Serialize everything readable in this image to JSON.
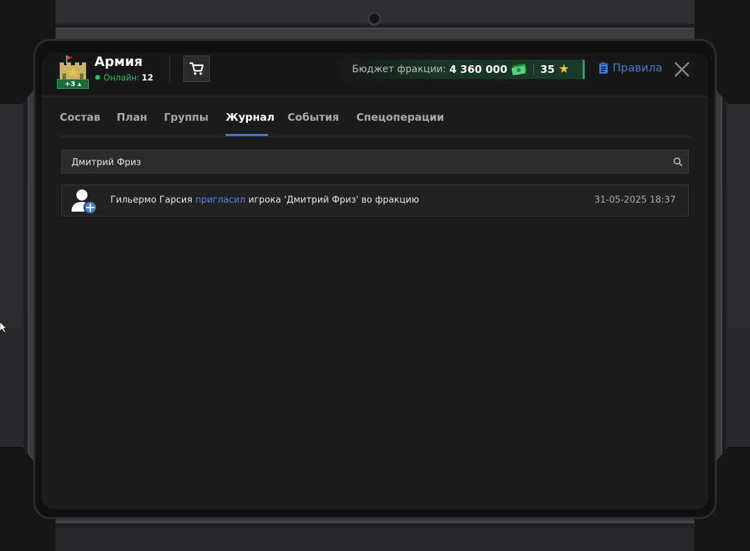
{
  "header": {
    "faction_name": "Армия",
    "online_label": "Онлайн:",
    "online_count": "12",
    "level_badge": "+3",
    "budget_label": "Бюджет фракции:",
    "budget_value": "4 360 000",
    "stars_value": "35",
    "rules_label": "Правила"
  },
  "tabs": [
    {
      "label": "Состав"
    },
    {
      "label": "План"
    },
    {
      "label": "Группы"
    },
    {
      "label": "Журнал",
      "active": true
    },
    {
      "label": "События"
    },
    {
      "label": "Спецоперации"
    }
  ],
  "search": {
    "value": "Дмитрий Фриз"
  },
  "log": [
    {
      "actor": "Гильермо Гарсия",
      "action": "пригласил",
      "rest": "игрока 'Дмитрий Фриз' во фракцию",
      "date": "31-05-2025 18:37",
      "icon": "user-add-icon"
    }
  ],
  "colors": {
    "accent": "#3e7cd6",
    "online": "#2ebd5e",
    "budget_border": "#2ea85a",
    "star": "#f4c430"
  }
}
